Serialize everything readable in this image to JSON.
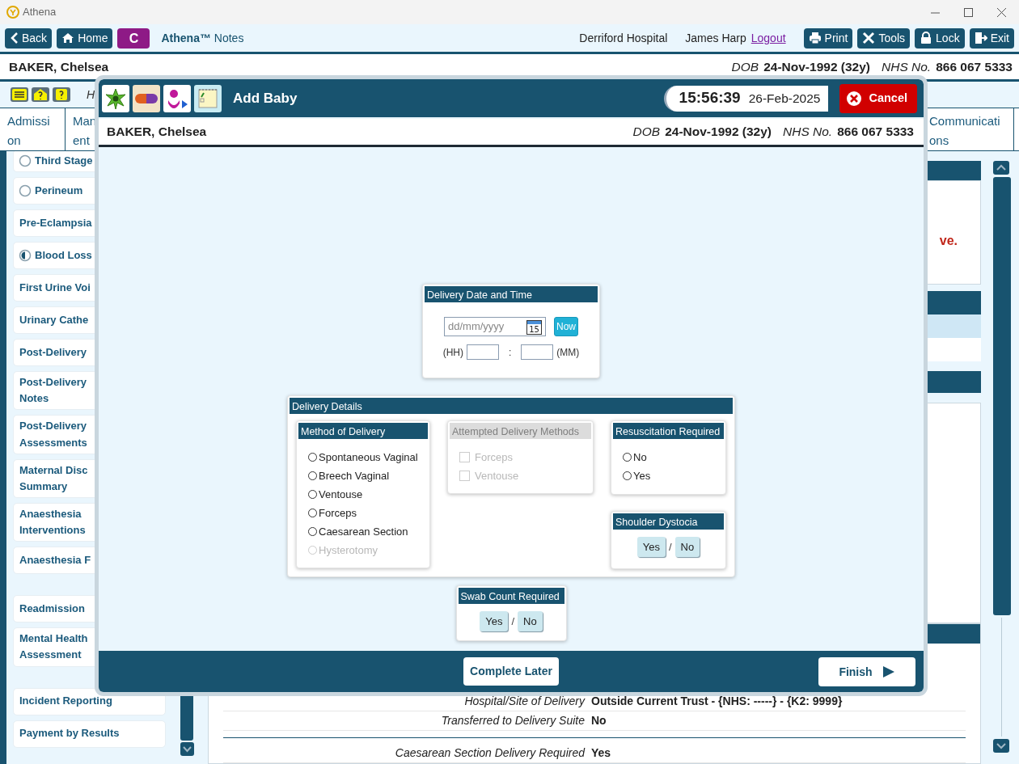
{
  "window": {
    "title": "Athena"
  },
  "toolbar": {
    "nav_buttons": [
      {
        "label": "Back"
      },
      {
        "label": "Home"
      }
    ],
    "patient_initial": "C",
    "app_name": "**Athena™** Notes",
    "hospital": "Derriford Hospital",
    "user": "James Harp",
    "logout": "Logout",
    "actions": [
      {
        "label": "Print"
      },
      {
        "label": "Tools"
      },
      {
        "label": "Lock"
      },
      {
        "label": "Exit"
      }
    ]
  },
  "patient": {
    "name": "BAKER, Chelsea",
    "dob_label": "DOB",
    "dob": "24-Nov-1992 (32y)",
    "nhs_label": "NHS No.",
    "nhs": "866 067 5333"
  },
  "hint_text": "H",
  "tabs": [
    {
      "label": "Admission",
      "selected": false
    },
    {
      "label": "Man\nent",
      "selected": false
    },
    {
      "label": "Communications",
      "selected": false
    }
  ],
  "sidebar": {
    "groups": [
      [
        {
          "label": "Third Stage",
          "kind": "empty"
        },
        {
          "label": "Perineum",
          "kind": "empty"
        },
        {
          "label": "Pre-Eclampsia",
          "kind": "plain"
        },
        {
          "label": "Blood Loss",
          "kind": "partial"
        },
        {
          "label": "First Urine Voi",
          "kind": "plain"
        },
        {
          "label": "Urinary Cathe",
          "kind": "plain"
        },
        {
          "label": "Post-Delivery",
          "kind": "plain"
        },
        {
          "label": "Post-Delivery Notes",
          "kind": "plain"
        },
        {
          "label": "Post-Delivery Assessments",
          "kind": "plain"
        },
        {
          "label": "Maternal Disc Summary",
          "kind": "plain"
        },
        {
          "label": "Anaesthesia Interventions",
          "kind": "plain"
        },
        {
          "label": "Anaesthesia F",
          "kind": "plain"
        }
      ],
      [
        {
          "label": "Readmission",
          "kind": "plain"
        },
        {
          "label": "Mental Health Assessment",
          "kind": "plain"
        }
      ],
      [
        {
          "label": "Incident Reporting",
          "kind": "plain"
        },
        {
          "label": "Payment by Results",
          "kind": "plain"
        }
      ]
    ]
  },
  "content": {
    "warning_fragment": "ve.",
    "rows": [
      {
        "label": "Hospital/Site of Delivery",
        "value": "Outside Current Trust - {NHS: -----} - {K2: 9999}"
      },
      {
        "label": "Transferred to Delivery Suite",
        "value": "No"
      },
      {
        "label": "Caesarean Section Delivery Required",
        "value": "Yes"
      }
    ]
  },
  "dialog": {
    "title": "Add Baby",
    "time": "15:56:39",
    "date": "26-Feb-2025",
    "cancel": "Cancel",
    "patient": {
      "name": "BAKER, Chelsea",
      "dob_label": "DOB",
      "dob": "24-Nov-1992 (32y)",
      "nhs_label": "NHS No.",
      "nhs": "866 067 5333"
    },
    "date_time": {
      "title": "Delivery Date and Time",
      "date_placeholder": "dd/mm/yyyy",
      "calendar_day": "15",
      "now": "Now",
      "hh_label": "(HH)",
      "separator": ":",
      "mm_label": "(MM)"
    },
    "details": {
      "title": "Delivery Details",
      "method": {
        "title": "Method of Delivery",
        "options": [
          {
            "label": "Spontaneous Vaginal",
            "selected": false,
            "disabled": false
          },
          {
            "label": "Breech Vaginal",
            "selected": false,
            "disabled": false
          },
          {
            "label": "Ventouse",
            "selected": false,
            "disabled": false
          },
          {
            "label": "Forceps",
            "selected": false,
            "disabled": false
          },
          {
            "label": "Caesarean Section",
            "selected": false,
            "disabled": false
          },
          {
            "label": "Hysterotomy",
            "selected": false,
            "disabled": true
          }
        ]
      },
      "attempted": {
        "title": "Attempted Delivery Methods",
        "disabled": true,
        "options": [
          {
            "label": "Forceps",
            "checked": false
          },
          {
            "label": "Ventouse",
            "checked": false
          }
        ]
      },
      "resuscitation": {
        "title": "Resuscitation Required",
        "options": [
          {
            "label": "No",
            "selected": false
          },
          {
            "label": "Yes",
            "selected": false
          }
        ]
      },
      "shoulder": {
        "title": "Shoulder Dystocia",
        "yes": "Yes",
        "separator": "/",
        "no": "No"
      }
    },
    "swab": {
      "title": "Swab Count Required",
      "yes": "Yes",
      "separator": "/",
      "no": "No"
    },
    "footer": {
      "complete_later": "Complete Later",
      "finish": "Finish"
    }
  }
}
